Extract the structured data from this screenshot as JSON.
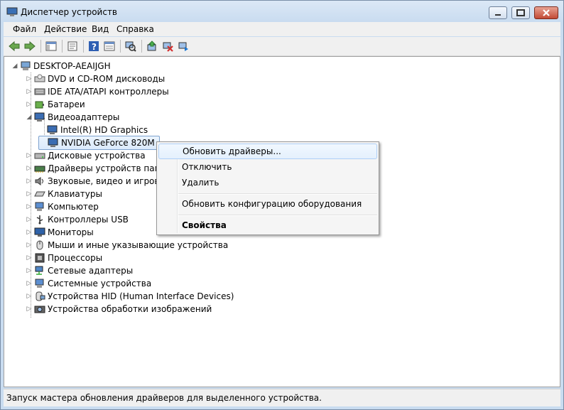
{
  "window": {
    "title": "Диспетчер устройств"
  },
  "menu": [
    "Файл",
    "Действие",
    "Вид",
    "Справка"
  ],
  "tree": {
    "root": "DESKTOP-AEAIJGH",
    "items": [
      "DVD и CD-ROM дисководы",
      "IDE ATA/ATAPI контроллеры",
      "Батареи",
      "Видеоадаптеры",
      "Intel(R) HD Graphics",
      "NVIDIA GeForce 820M",
      "Дисковые устройства",
      "Драйверы устройств памяти",
      "Звуковые, видео и игровые устройства",
      "Клавиатуры",
      "Компьютер",
      "Контроллеры USB",
      "Мониторы",
      "Мыши и иные указывающие устройства",
      "Процессоры",
      "Сетевые адаптеры",
      "Системные устройства",
      "Устройства HID (Human Interface Devices)",
      "Устройства обработки изображений"
    ]
  },
  "context_menu": {
    "update": "Обновить драйверы...",
    "disable": "Отключить",
    "uninstall": "Удалить",
    "scan": "Обновить конфигурацию оборудования",
    "properties": "Свойства"
  },
  "status": "Запуск мастера обновления драйверов для выделенного устройства.",
  "colors": {
    "selection": "#dbeafc",
    "window_frame": "#c9dcf0"
  }
}
